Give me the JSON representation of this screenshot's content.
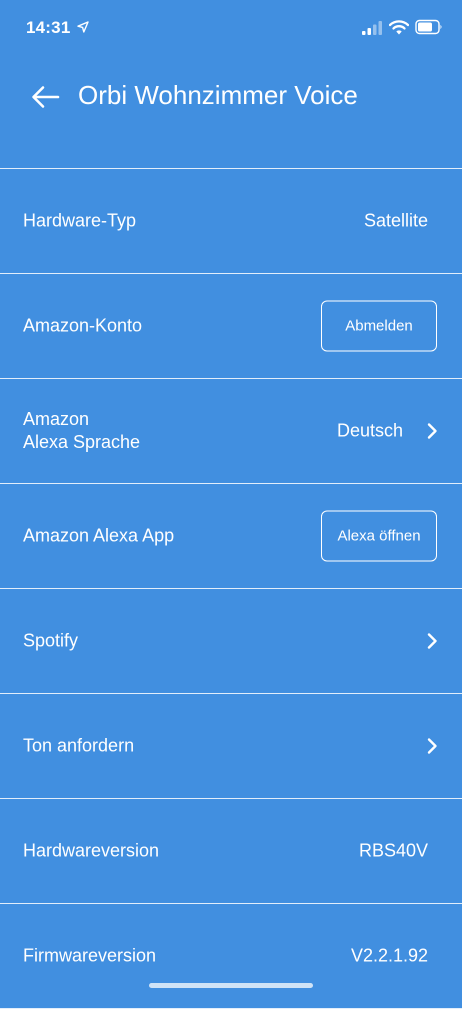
{
  "status_bar": {
    "time": "14:31"
  },
  "header": {
    "title": "Orbi Wohnzimmer Voice"
  },
  "rows": [
    {
      "label": "Hardware-Typ",
      "value": "Satellite"
    },
    {
      "label": "Amazon-Konto",
      "button_label": "Abmelden"
    },
    {
      "label_line1": "Amazon",
      "label_line2": "Alexa Sprache",
      "value": "Deutsch"
    },
    {
      "label": "Amazon Alexa App",
      "button_label": "Alexa öffnen"
    },
    {
      "label": "Spotify"
    },
    {
      "label": "Ton anfordern"
    },
    {
      "label": "Hardwareversion",
      "value": "RBS40V"
    },
    {
      "label": "Firmwareversion",
      "value": "V2.2.1.92"
    }
  ],
  "icons": {
    "back": "arrow-left-icon",
    "chevron": "chevron-right-icon",
    "location": "location-arrow-icon",
    "signal": "cellular-signal-icon",
    "wifi": "wifi-icon",
    "battery": "battery-icon"
  },
  "colors": {
    "background": "#418fe0",
    "foreground": "#ffffff"
  }
}
